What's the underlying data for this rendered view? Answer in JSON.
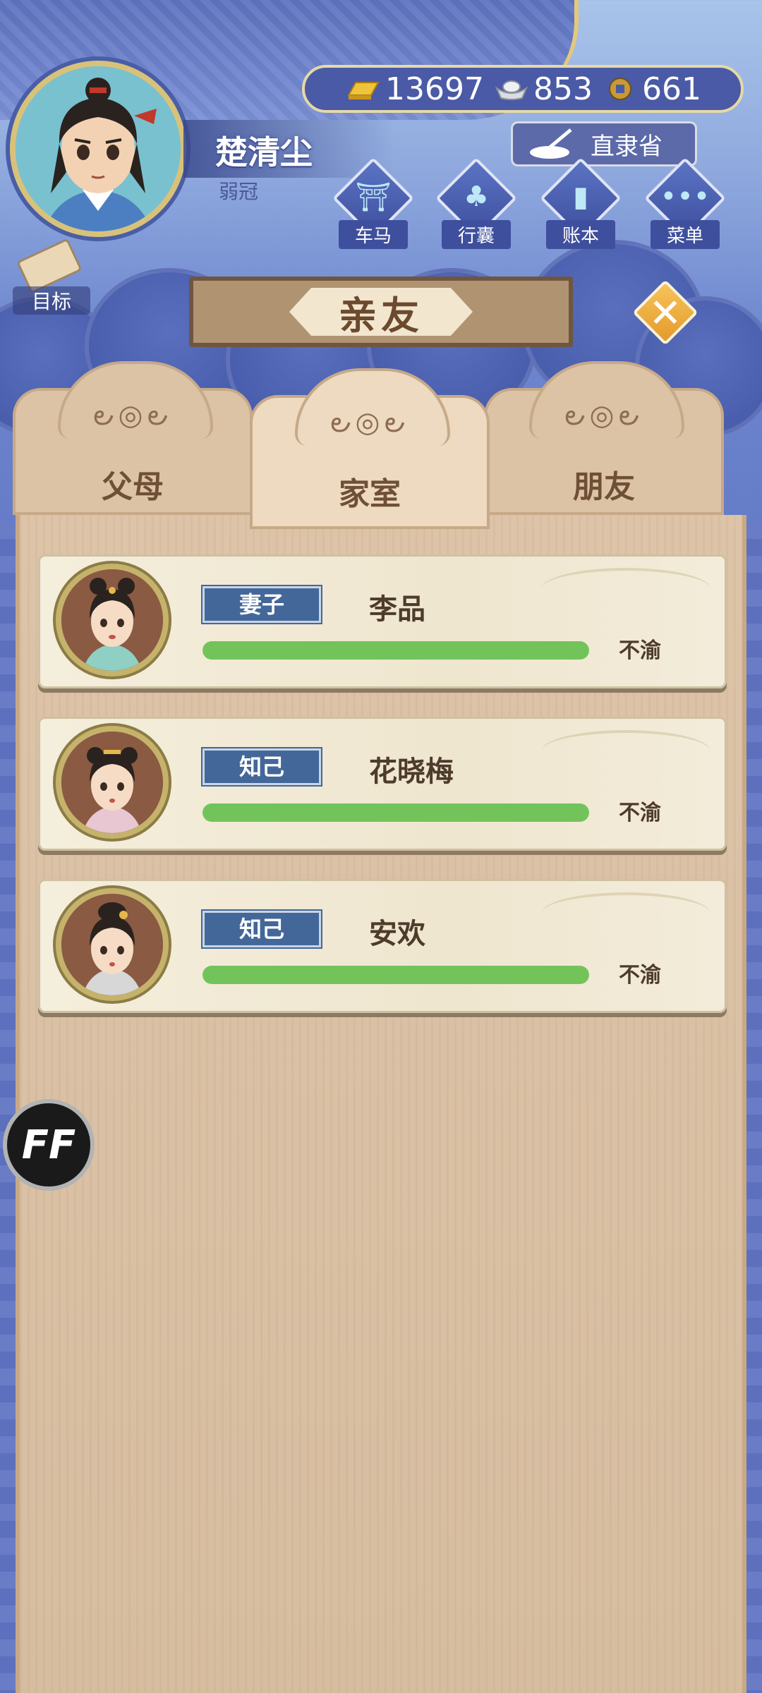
{
  "player": {
    "name": "楚清尘",
    "title": "弱冠"
  },
  "currency": {
    "gold": "13697",
    "silver": "853",
    "coins": "661"
  },
  "location": "直隶省",
  "nav": [
    {
      "label": "车马",
      "icon": "carriage-icon"
    },
    {
      "label": "行囊",
      "icon": "bag-icon"
    },
    {
      "label": "账本",
      "icon": "ledger-icon"
    },
    {
      "label": "菜单",
      "icon": "menu-dots-icon"
    }
  ],
  "goal_label": "目标",
  "banner_title": "亲友",
  "tabs": [
    {
      "label": "父母",
      "active": false
    },
    {
      "label": "家室",
      "active": true
    },
    {
      "label": "朋友",
      "active": false
    }
  ],
  "relations": [
    {
      "tag": "妻子",
      "name": "李品",
      "status": "不渝",
      "bar": 1.0
    },
    {
      "tag": "知己",
      "name": "花晓梅",
      "status": "不渝",
      "bar": 1.0
    },
    {
      "tag": "知己",
      "name": "安欢",
      "status": "不渝",
      "bar": 1.0
    }
  ],
  "ff_label": "FF",
  "colors": {
    "accent_gold": "#e49b2b",
    "bar_green": "#72c45a",
    "tag_blue": "#44679a"
  }
}
